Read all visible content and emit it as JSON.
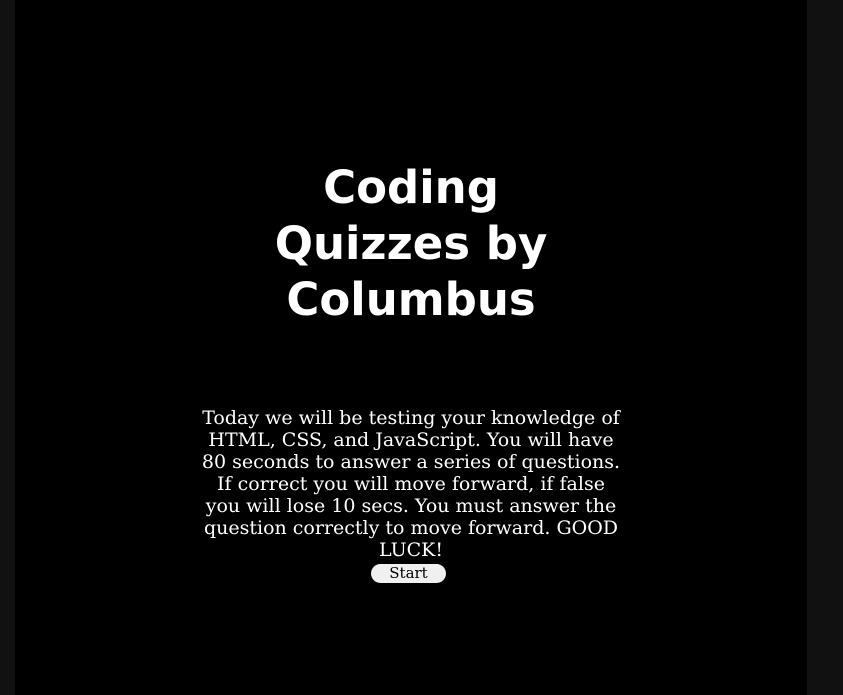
{
  "quiz": {
    "title_lines": [
      "Coding",
      "Quizzes by",
      "Columbus"
    ],
    "intro_text": "Today we will be testing your knowledge of HTML, CSS, and JavaScript. You will have 80 seconds to answer a series of questions. If correct you will move forward, if false you will lose 10 secs. You must answer the question correctly to move forward. GOOD LUCK!",
    "start_label": "Start"
  },
  "colors": {
    "page_background": "#111111",
    "panel_background": "#000000",
    "text": "#ffffff",
    "button_background": "#f0f0f0",
    "button_text": "#000000"
  }
}
